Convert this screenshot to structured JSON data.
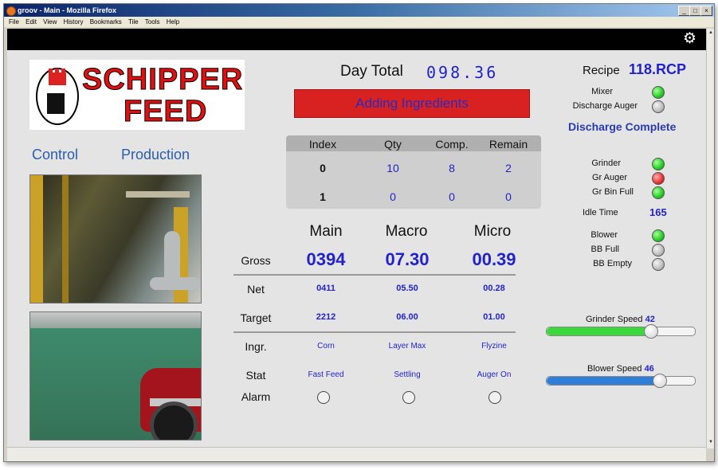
{
  "window": {
    "title": "groov - Main - Mozilla Firefox"
  },
  "menu": [
    "File",
    "Edit",
    "View",
    "History",
    "Bookmarks",
    "Tile",
    "Tools",
    "Help"
  ],
  "logo": {
    "line1": "SCHIPPER",
    "line2": "FEED"
  },
  "nav": {
    "control": "Control",
    "production": "Production"
  },
  "day_total": {
    "label": "Day Total",
    "value": "098.36"
  },
  "status": "Adding Ingredients",
  "progress_table": {
    "headers": [
      "Index",
      "Qty",
      "Comp.",
      "Remain"
    ],
    "rows": [
      [
        "0",
        "10",
        "8",
        "2"
      ],
      [
        "1",
        "0",
        "0",
        "0"
      ]
    ]
  },
  "scales": {
    "columns": [
      "Main",
      "Macro",
      "Micro"
    ],
    "row_labels": {
      "gross": "Gross",
      "net": "Net",
      "target": "Target",
      "ingr": "Ingr.",
      "stat": "Stat",
      "alarm": "Alarm"
    },
    "gross": [
      "0394",
      "07.30",
      "00.39"
    ],
    "net": [
      "0411",
      "05.50",
      "00.28"
    ],
    "target": [
      "2212",
      "06.00",
      "01.00"
    ],
    "ingr": [
      "Corn",
      "Layer Max",
      "Flyzine"
    ],
    "stat": [
      "Fast Feed",
      "Settling",
      "Auger On"
    ]
  },
  "recipe": {
    "label": "Recipe",
    "value": "118.RCP"
  },
  "indicators": {
    "mixer": {
      "label": "Mixer",
      "state": "green"
    },
    "discharge_auger": {
      "label": "Discharge Auger",
      "state": "grey"
    },
    "grinder": {
      "label": "Grinder",
      "state": "green"
    },
    "gr_auger": {
      "label": "Gr Auger",
      "state": "red"
    },
    "gr_bin_full": {
      "label": "Gr Bin Full",
      "state": "green"
    },
    "blower": {
      "label": "Blower",
      "state": "green"
    },
    "bb_full": {
      "label": "BB Full",
      "state": "grey"
    },
    "bb_empty": {
      "label": "BB Empty",
      "state": "grey"
    }
  },
  "discharge_status": "Discharge Complete",
  "idle_time": {
    "label": "Idle Time",
    "value": "165"
  },
  "grinder_speed": {
    "label": "Grinder Speed",
    "value": "42",
    "percent": 70,
    "color": "#3bd83b"
  },
  "blower_speed": {
    "label": "Blower Speed",
    "value": "46",
    "percent": 76,
    "color": "#2f7fd8"
  }
}
